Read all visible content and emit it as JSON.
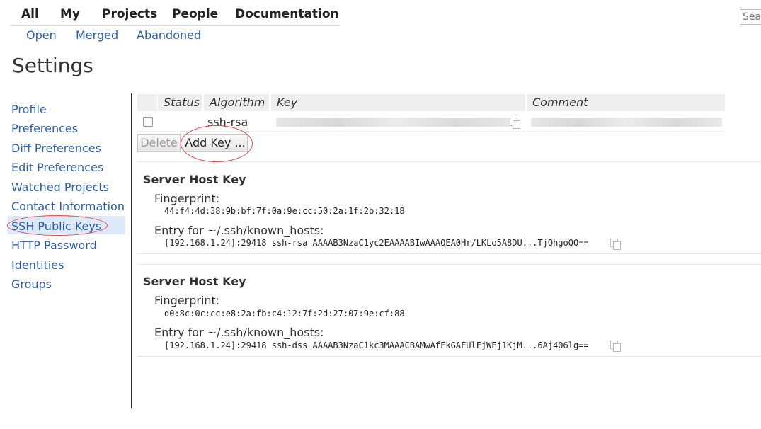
{
  "top_nav": {
    "items": [
      "All",
      "My",
      "Projects",
      "People",
      "Documentation"
    ]
  },
  "sub_nav": {
    "items": [
      "Open",
      "Merged",
      "Abandoned"
    ]
  },
  "search": {
    "placeholder": "Sea"
  },
  "page_title": "Settings",
  "sidebar": {
    "items": [
      "Profile",
      "Preferences",
      "Diff Preferences",
      "Edit Preferences",
      "Watched Projects",
      "Contact Information",
      "SSH Public Keys",
      "HTTP Password",
      "Identities",
      "Groups"
    ],
    "selected": "SSH Public Keys"
  },
  "keys_table": {
    "columns": [
      "Status",
      "Algorithm",
      "Key",
      "Comment"
    ],
    "rows": [
      {
        "algorithm": "ssh-rsa"
      }
    ]
  },
  "buttons": {
    "delete": "Delete",
    "add_key": "Add Key ..."
  },
  "host_keys": [
    {
      "title": "Server Host Key",
      "fingerprint_label": "Fingerprint:",
      "fingerprint": "44:f4:4d:38:9b:bf:7f:0a:9e:cc:50:2a:1f:2b:32:18",
      "entry_label": "Entry for ~/.ssh/known_hosts:",
      "entry": "[192.168.1.24]:29418 ssh-rsa AAAAB3NzaC1yc2EAAAABIwAAAQEA0Hr/LKLo5A8DU...TjQhgoQQ=="
    },
    {
      "title": "Server Host Key",
      "fingerprint_label": "Fingerprint:",
      "fingerprint": "d0:8c:0c:cc:e8:2a:fb:c4:12:7f:2d:27:07:9e:cf:88",
      "entry_label": "Entry for ~/.ssh/known_hosts:",
      "entry": "[192.168.1.24]:29418 ssh-dss AAAAB3NzaC1kc3MAAACBAMwAfFkGAFUlFjWEj1KjM...6Aj406lg=="
    }
  ],
  "colors": {
    "link": "#2a5db0",
    "highlight": "#dde8f8",
    "annotation": "#e04a4a"
  }
}
